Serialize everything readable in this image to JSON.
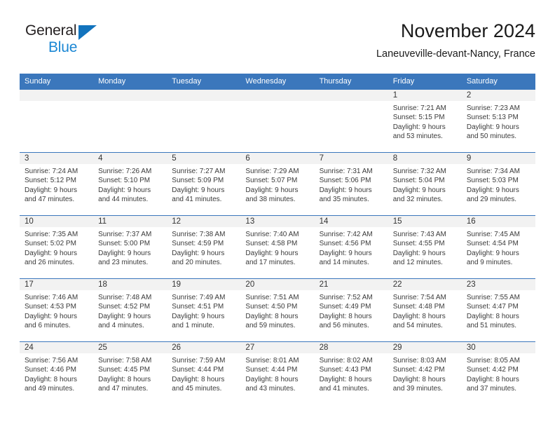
{
  "logo": {
    "line1": "General",
    "line2": "Blue",
    "triangle_color": "#1273bd",
    "blue_text_color": "#1b87d4"
  },
  "header": {
    "title": "November 2024",
    "subtitle": "Laneuveville-devant-Nancy, France"
  },
  "theme": {
    "header_blue": "#3b77bc",
    "daynum_band": "#f2f2f2",
    "text": "#3a3a3a"
  },
  "weekday_headers": [
    "Sunday",
    "Monday",
    "Tuesday",
    "Wednesday",
    "Thursday",
    "Friday",
    "Saturday"
  ],
  "weeks": [
    [
      {
        "day": "",
        "empty": true
      },
      {
        "day": "",
        "empty": true
      },
      {
        "day": "",
        "empty": true
      },
      {
        "day": "",
        "empty": true
      },
      {
        "day": "",
        "empty": true
      },
      {
        "day": "1",
        "sunrise": "Sunrise: 7:21 AM",
        "sunset": "Sunset: 5:15 PM",
        "daylight1": "Daylight: 9 hours",
        "daylight2": "and 53 minutes."
      },
      {
        "day": "2",
        "sunrise": "Sunrise: 7:23 AM",
        "sunset": "Sunset: 5:13 PM",
        "daylight1": "Daylight: 9 hours",
        "daylight2": "and 50 minutes."
      }
    ],
    [
      {
        "day": "3",
        "sunrise": "Sunrise: 7:24 AM",
        "sunset": "Sunset: 5:12 PM",
        "daylight1": "Daylight: 9 hours",
        "daylight2": "and 47 minutes."
      },
      {
        "day": "4",
        "sunrise": "Sunrise: 7:26 AM",
        "sunset": "Sunset: 5:10 PM",
        "daylight1": "Daylight: 9 hours",
        "daylight2": "and 44 minutes."
      },
      {
        "day": "5",
        "sunrise": "Sunrise: 7:27 AM",
        "sunset": "Sunset: 5:09 PM",
        "daylight1": "Daylight: 9 hours",
        "daylight2": "and 41 minutes."
      },
      {
        "day": "6",
        "sunrise": "Sunrise: 7:29 AM",
        "sunset": "Sunset: 5:07 PM",
        "daylight1": "Daylight: 9 hours",
        "daylight2": "and 38 minutes."
      },
      {
        "day": "7",
        "sunrise": "Sunrise: 7:31 AM",
        "sunset": "Sunset: 5:06 PM",
        "daylight1": "Daylight: 9 hours",
        "daylight2": "and 35 minutes."
      },
      {
        "day": "8",
        "sunrise": "Sunrise: 7:32 AM",
        "sunset": "Sunset: 5:04 PM",
        "daylight1": "Daylight: 9 hours",
        "daylight2": "and 32 minutes."
      },
      {
        "day": "9",
        "sunrise": "Sunrise: 7:34 AM",
        "sunset": "Sunset: 5:03 PM",
        "daylight1": "Daylight: 9 hours",
        "daylight2": "and 29 minutes."
      }
    ],
    [
      {
        "day": "10",
        "sunrise": "Sunrise: 7:35 AM",
        "sunset": "Sunset: 5:02 PM",
        "daylight1": "Daylight: 9 hours",
        "daylight2": "and 26 minutes."
      },
      {
        "day": "11",
        "sunrise": "Sunrise: 7:37 AM",
        "sunset": "Sunset: 5:00 PM",
        "daylight1": "Daylight: 9 hours",
        "daylight2": "and 23 minutes."
      },
      {
        "day": "12",
        "sunrise": "Sunrise: 7:38 AM",
        "sunset": "Sunset: 4:59 PM",
        "daylight1": "Daylight: 9 hours",
        "daylight2": "and 20 minutes."
      },
      {
        "day": "13",
        "sunrise": "Sunrise: 7:40 AM",
        "sunset": "Sunset: 4:58 PM",
        "daylight1": "Daylight: 9 hours",
        "daylight2": "and 17 minutes."
      },
      {
        "day": "14",
        "sunrise": "Sunrise: 7:42 AM",
        "sunset": "Sunset: 4:56 PM",
        "daylight1": "Daylight: 9 hours",
        "daylight2": "and 14 minutes."
      },
      {
        "day": "15",
        "sunrise": "Sunrise: 7:43 AM",
        "sunset": "Sunset: 4:55 PM",
        "daylight1": "Daylight: 9 hours",
        "daylight2": "and 12 minutes."
      },
      {
        "day": "16",
        "sunrise": "Sunrise: 7:45 AM",
        "sunset": "Sunset: 4:54 PM",
        "daylight1": "Daylight: 9 hours",
        "daylight2": "and 9 minutes."
      }
    ],
    [
      {
        "day": "17",
        "sunrise": "Sunrise: 7:46 AM",
        "sunset": "Sunset: 4:53 PM",
        "daylight1": "Daylight: 9 hours",
        "daylight2": "and 6 minutes."
      },
      {
        "day": "18",
        "sunrise": "Sunrise: 7:48 AM",
        "sunset": "Sunset: 4:52 PM",
        "daylight1": "Daylight: 9 hours",
        "daylight2": "and 4 minutes."
      },
      {
        "day": "19",
        "sunrise": "Sunrise: 7:49 AM",
        "sunset": "Sunset: 4:51 PM",
        "daylight1": "Daylight: 9 hours",
        "daylight2": "and 1 minute."
      },
      {
        "day": "20",
        "sunrise": "Sunrise: 7:51 AM",
        "sunset": "Sunset: 4:50 PM",
        "daylight1": "Daylight: 8 hours",
        "daylight2": "and 59 minutes."
      },
      {
        "day": "21",
        "sunrise": "Sunrise: 7:52 AM",
        "sunset": "Sunset: 4:49 PM",
        "daylight1": "Daylight: 8 hours",
        "daylight2": "and 56 minutes."
      },
      {
        "day": "22",
        "sunrise": "Sunrise: 7:54 AM",
        "sunset": "Sunset: 4:48 PM",
        "daylight1": "Daylight: 8 hours",
        "daylight2": "and 54 minutes."
      },
      {
        "day": "23",
        "sunrise": "Sunrise: 7:55 AM",
        "sunset": "Sunset: 4:47 PM",
        "daylight1": "Daylight: 8 hours",
        "daylight2": "and 51 minutes."
      }
    ],
    [
      {
        "day": "24",
        "sunrise": "Sunrise: 7:56 AM",
        "sunset": "Sunset: 4:46 PM",
        "daylight1": "Daylight: 8 hours",
        "daylight2": "and 49 minutes."
      },
      {
        "day": "25",
        "sunrise": "Sunrise: 7:58 AM",
        "sunset": "Sunset: 4:45 PM",
        "daylight1": "Daylight: 8 hours",
        "daylight2": "and 47 minutes."
      },
      {
        "day": "26",
        "sunrise": "Sunrise: 7:59 AM",
        "sunset": "Sunset: 4:44 PM",
        "daylight1": "Daylight: 8 hours",
        "daylight2": "and 45 minutes."
      },
      {
        "day": "27",
        "sunrise": "Sunrise: 8:01 AM",
        "sunset": "Sunset: 4:44 PM",
        "daylight1": "Daylight: 8 hours",
        "daylight2": "and 43 minutes."
      },
      {
        "day": "28",
        "sunrise": "Sunrise: 8:02 AM",
        "sunset": "Sunset: 4:43 PM",
        "daylight1": "Daylight: 8 hours",
        "daylight2": "and 41 minutes."
      },
      {
        "day": "29",
        "sunrise": "Sunrise: 8:03 AM",
        "sunset": "Sunset: 4:42 PM",
        "daylight1": "Daylight: 8 hours",
        "daylight2": "and 39 minutes."
      },
      {
        "day": "30",
        "sunrise": "Sunrise: 8:05 AM",
        "sunset": "Sunset: 4:42 PM",
        "daylight1": "Daylight: 8 hours",
        "daylight2": "and 37 minutes."
      }
    ]
  ]
}
